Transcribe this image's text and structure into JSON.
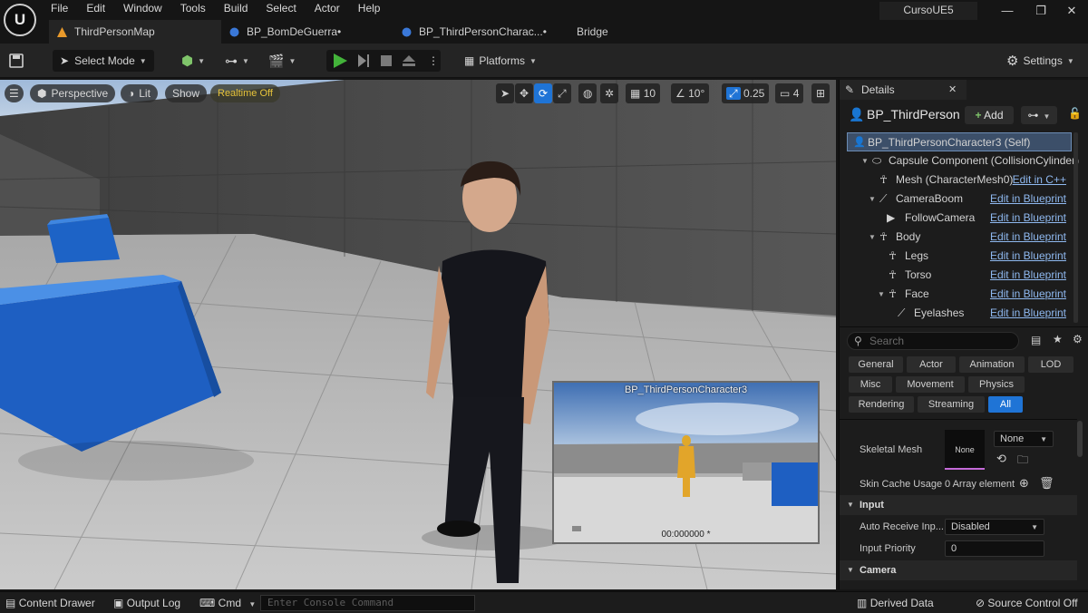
{
  "app": {
    "logo_letter": "U",
    "project": "CursoUE5"
  },
  "menu": [
    "File",
    "Edit",
    "Window",
    "Tools",
    "Build",
    "Select",
    "Actor",
    "Help"
  ],
  "tabs": [
    {
      "label": "ThirdPersonMap",
      "icon": "level-icon",
      "active": true
    },
    {
      "label": "BP_BomDeGuerra•",
      "icon": "blueprint-icon",
      "active": false
    },
    {
      "label": "BP_ThirdPersonCharac...•",
      "icon": "blueprint-icon",
      "active": false
    },
    {
      "label": "Bridge",
      "icon": "",
      "active": false
    }
  ],
  "toolbar": {
    "select_mode": "Select Mode",
    "platforms": "Platforms",
    "settings": "Settings"
  },
  "viewport": {
    "perspective": "Perspective",
    "lit": "Lit",
    "show": "Show",
    "realtime": "Realtime Off",
    "grid_snap": "10",
    "rotation_snap": "10°",
    "scale_snap": "0.25",
    "camera_speed": "4"
  },
  "preview": {
    "title": "BP_ThirdPersonCharacter3",
    "time": "00:000000 *"
  },
  "details": {
    "tab": "Details",
    "actor": "BP_ThirdPerson",
    "add": "Add",
    "components": [
      {
        "label": "BP_ThirdPersonCharacter3 (Self)",
        "indent": 0,
        "selected": true,
        "edit": ""
      },
      {
        "label": "Capsule Component (CollisionCylinder)",
        "indent": 1,
        "edit": ""
      },
      {
        "label": "Mesh (CharacterMesh0)",
        "indent": 2,
        "edit": "Edit in C++"
      },
      {
        "label": "CameraBoom",
        "indent": 2,
        "edit": "Edit in Blueprint"
      },
      {
        "label": "FollowCamera",
        "indent": 3,
        "edit": "Edit in Blueprint"
      },
      {
        "label": "Body",
        "indent": 2,
        "edit": "Edit in Blueprint"
      },
      {
        "label": "Legs",
        "indent": 3,
        "edit": "Edit in Blueprint"
      },
      {
        "label": "Torso",
        "indent": 3,
        "edit": "Edit in Blueprint"
      },
      {
        "label": "Face",
        "indent": 3,
        "edit": "Edit in Blueprint"
      },
      {
        "label": "Eyelashes",
        "indent": 4,
        "edit": "Edit in Blueprint"
      }
    ],
    "search_placeholder": "Search",
    "categories": [
      [
        "General",
        "Actor",
        "Animation",
        "LOD"
      ],
      [
        "Misc",
        "Movement",
        "Physics"
      ],
      [
        "Rendering",
        "Streaming",
        "All"
      ]
    ],
    "active_category": "All",
    "props": {
      "skeletal_mesh_label": "Skeletal Mesh",
      "skeletal_mesh_thumb": "None",
      "skeletal_mesh_value": "None",
      "skin_cache_label": "Skin Cache Usage",
      "skin_cache_value": "0 Array element",
      "input_section": "Input",
      "auto_receive_label": "Auto Receive Inp...",
      "auto_receive_value": "Disabled",
      "input_priority_label": "Input Priority",
      "input_priority_value": "0",
      "camera_section": "Camera"
    }
  },
  "bottombar": {
    "content_drawer": "Content Drawer",
    "output_log": "Output Log",
    "cmd": "Cmd",
    "console_placeholder": "Enter Console Command",
    "derived_data": "Derived Data",
    "source_control": "Source Control Off"
  },
  "colors": {
    "accent": "#1f74d6",
    "play": "#43b33a",
    "link": "#8fb9f0",
    "selection": "#3c4f69"
  }
}
